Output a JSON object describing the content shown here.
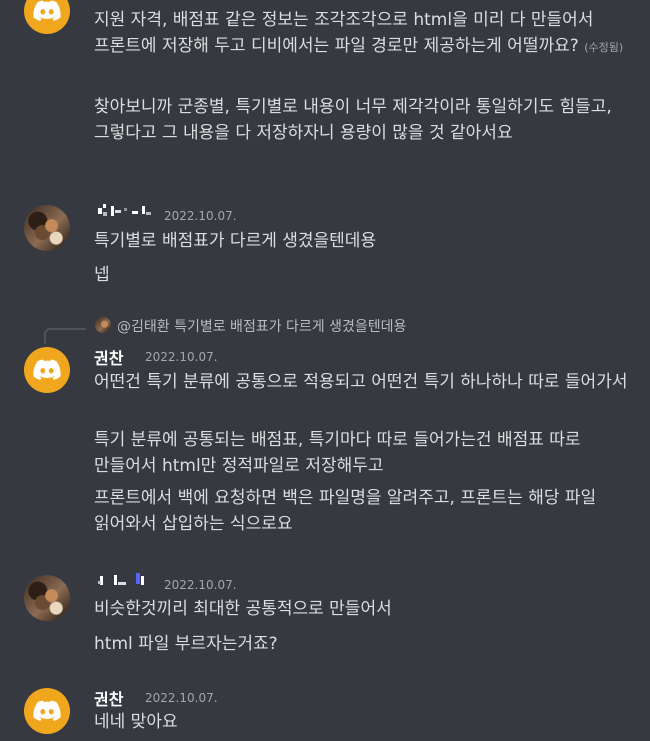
{
  "messages": {
    "m1": {
      "p1": "지원 자격, 배점표 같은 정보는 조각조각으로 html을 미리 다 만들어서 프론트에 저장해 두고 디비에서는 파일 경로만 제공하는게 어떨까요?",
      "edited": "(수정됨)",
      "p2": "찾아보니까 군종별, 특기별로 내용이 너무 제각각이라 통일하기도 힘들고, 그렇다고 그 내용을 다 저장하자니 용량이 많을 것 같아서요"
    },
    "m2": {
      "timestamp": "2022.10.07.",
      "p1": "특기별로 배점표가 다르게 생겼을텐데용",
      "p2": "넵"
    },
    "reply": {
      "text": "@김태환 특기별로 배점표가 다르게 생겼을텐데용"
    },
    "m3": {
      "name": "권찬",
      "timestamp": "2022.10.07.",
      "p1": "어떤건 특기 분류에 공통으로 적용되고 어떤건 특기 하나하나 따로 들어가서",
      "p2": "특기 분류에 공통되는 배점표, 특기마다 따로 들어가는건 배점표 따로 만들어서 html만 정적파일로 저장해두고",
      "p3": "프론트에서 백에 요청하면 백은 파일명을 알려주고, 프론트는 해당 파일 읽어와서 삽입하는 식으로요"
    },
    "m4": {
      "timestamp": "2022.10.07.",
      "p1": "비슷한것끼리 최대한 공통적으로 만들어서",
      "p2": "html 파일 부르자는거죠?"
    },
    "m5": {
      "name": "권찬",
      "timestamp": "2022.10.07.",
      "p1": "네네 맞아요"
    }
  },
  "colors": {
    "background": "#36393f",
    "discord_avatar": "#f0a71e",
    "text": "#dcddde",
    "muted": "#a3a6aa"
  }
}
